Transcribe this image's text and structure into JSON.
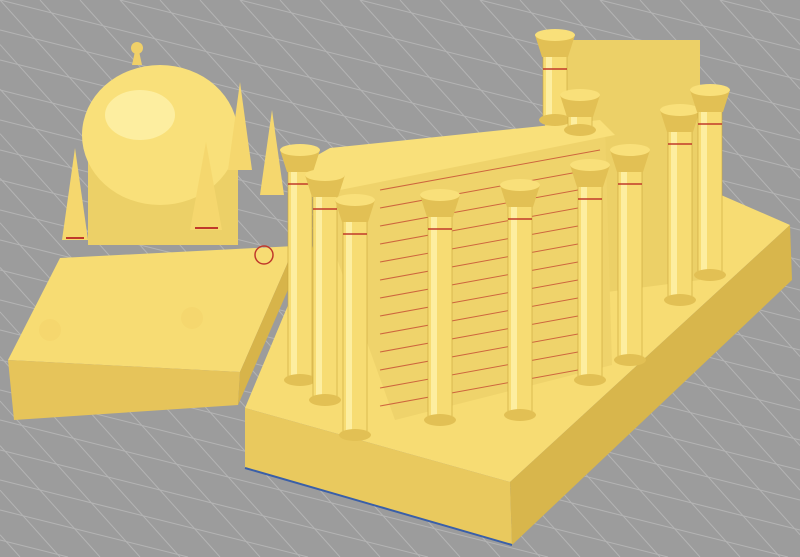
{
  "viewport": {
    "background": "#9c9c9c",
    "grid_color": "#b4b4b4",
    "model_color": "#f7dc73",
    "model_shade": "#e2c054",
    "model_dark": "#c9a53c",
    "accent_line": "#c0392b",
    "base_edge": "#3a5fa8"
  }
}
